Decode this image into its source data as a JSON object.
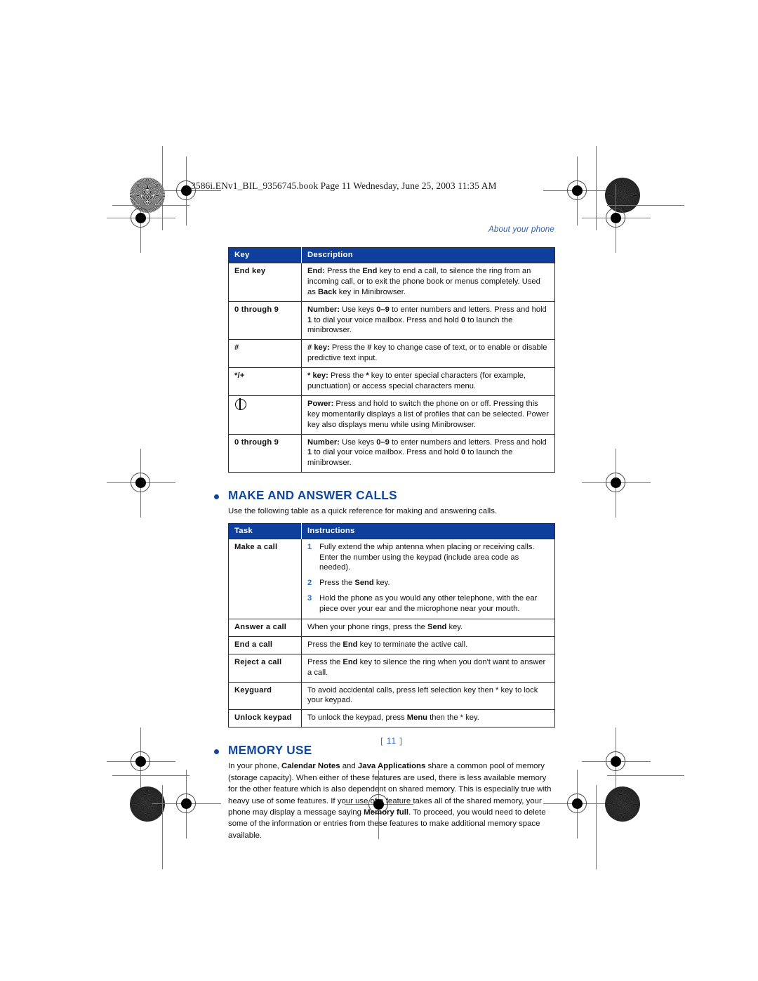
{
  "print_header": "3586i.ENv1_BIL_9356745.book  Page 11  Wednesday, June 25, 2003  11:35 AM",
  "running_header": "About your phone",
  "page_number": "[ 11 ]",
  "keys_table": {
    "headers": [
      "Key",
      "Description"
    ],
    "rows": [
      {
        "key": "End key",
        "key_icon": "",
        "desc_html": "<b>End:</b> Press the <b>End</b> key to end a call, to silence the ring from an incoming call, or to exit the phone book or menus completely. Used as <b>Back</b> key in Minibrowser."
      },
      {
        "key": "0 through 9",
        "key_icon": "",
        "desc_html": "<b>Number:</b> Use keys <b>0–9</b> to enter numbers and letters. Press and hold <b>1</b> to dial your voice mailbox. Press and hold <b>0</b> to launch the minibrowser."
      },
      {
        "key": "#",
        "key_icon": "",
        "desc_html": "<b># key:</b> Press the <b>#</b> key to change case of text, or to enable or disable predictive text input."
      },
      {
        "key": "*/+",
        "key_icon": "",
        "desc_html": "<b>* key:</b> Press the <b>*</b> key to enter special characters (for example, punctuation) or access special characters menu."
      },
      {
        "key": "",
        "key_icon": "power-icon",
        "desc_html": "<b>Power:</b> Press and hold to switch the phone on or off. Pressing this key momentarily displays a list of profiles that can be selected. Power key also displays menu while using Minibrowser."
      },
      {
        "key": "0 through 9",
        "key_icon": "",
        "desc_html": "<b>Number:</b> Use keys <b>0–9</b> to enter numbers and letters. Press and hold <b>1</b> to dial your voice mailbox. Press and hold <b>0</b> to launch the minibrowser."
      }
    ]
  },
  "make_answer": {
    "heading": "MAKE AND ANSWER CALLS",
    "intro": "Use the following table as a quick reference for making and answering calls.",
    "table": {
      "headers": [
        "Task",
        "Instructions"
      ],
      "rows": [
        {
          "task": "Make a call",
          "steps": [
            "Fully extend the whip antenna when placing or receiving calls. Enter the number using the keypad (include area code as needed).",
            "Press the <b>Send</b> key.",
            "Hold the phone as you would any other telephone, with the ear piece over your ear and the microphone near your mouth."
          ],
          "step_numbers": [
            "1",
            "2",
            "3"
          ]
        },
        {
          "task": "Answer a call",
          "desc_html": "When your phone rings, press the <b>Send</b> key."
        },
        {
          "task": "End a call",
          "desc_html": "Press the <b>End</b> key to terminate the active call."
        },
        {
          "task": "Reject a call",
          "desc_html": "Press the <b>End</b> key to silence the ring when you don't want to answer a call."
        },
        {
          "task": "Keyguard",
          "desc_html": "To avoid accidental calls, press left selection key then * key to lock your keypad."
        },
        {
          "task": "Unlock keypad",
          "desc_html": "To unlock the keypad, press <b>Menu</b> then the * key."
        }
      ]
    }
  },
  "memory_use": {
    "heading": "MEMORY USE",
    "body_html": "In your phone, <b>Calendar Notes</b> and <b>Java Applications</b> share a common pool of memory (storage capacity). When either of these features are used, there is less available memory for the other feature which is also dependent on shared memory. This is especially true with heavy use of some features. If your use of a feature takes all of the shared memory, your phone may display a message saying <b>Memory full</b>. To proceed, you would need to delete some of the information or entries from these features to make additional memory space available."
  },
  "colors": {
    "heading_blue": "#11479f",
    "table_header_blue": "#0f3f9c",
    "accent_blue": "#2f6bc4"
  }
}
